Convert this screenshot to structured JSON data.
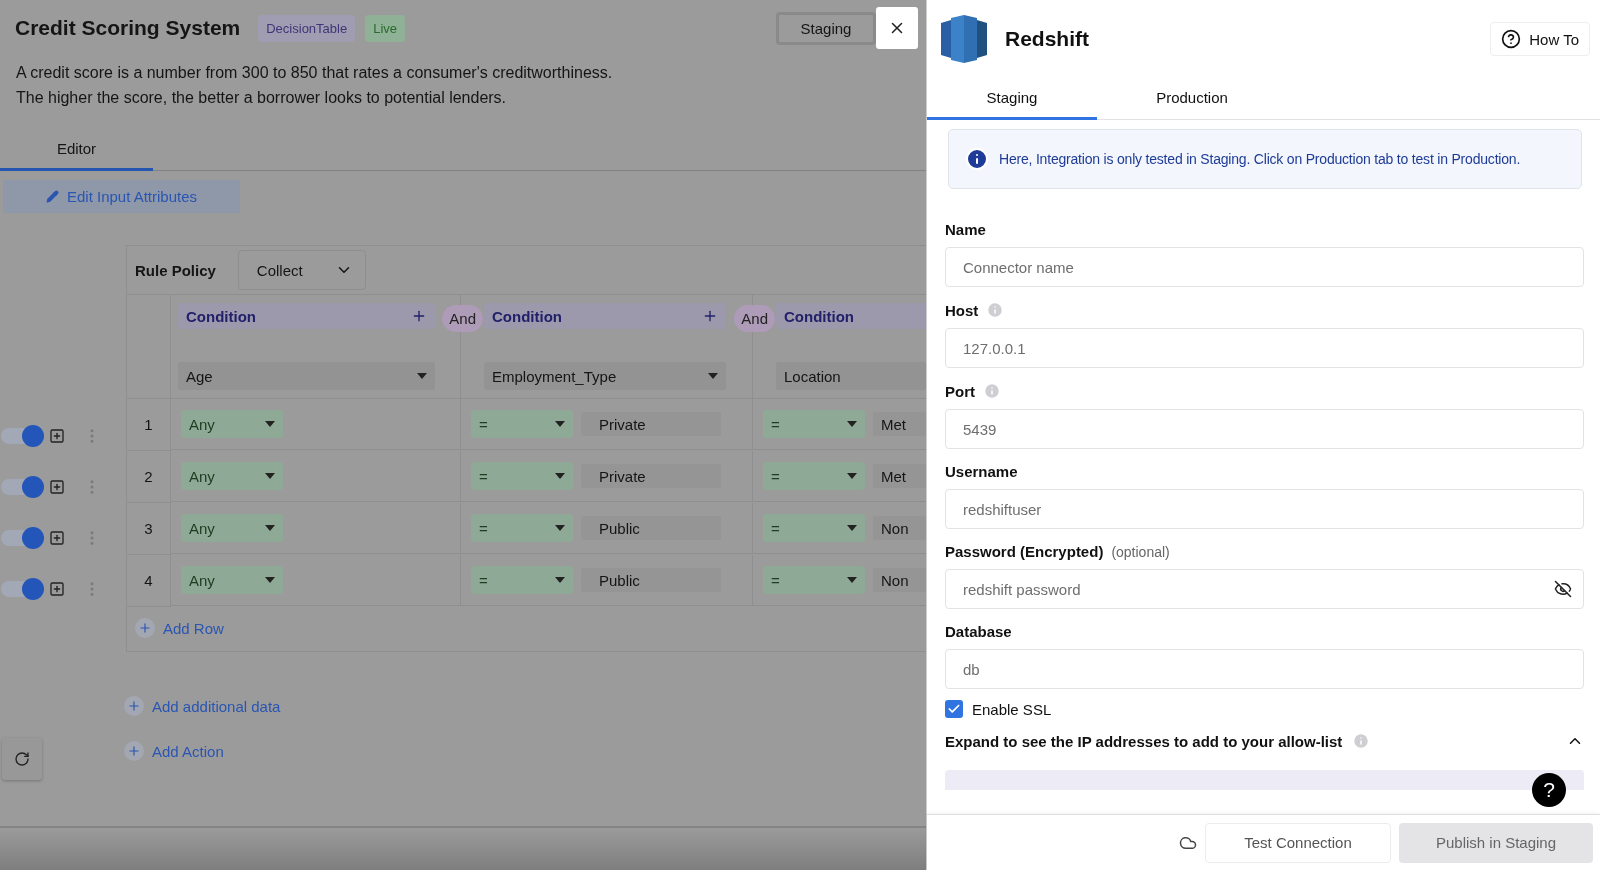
{
  "page": {
    "title": "Credit Scoring System",
    "badges": [
      {
        "label": "DecisionTable",
        "kind": "type"
      },
      {
        "label": "Live",
        "kind": "status"
      }
    ],
    "env_button": "Staging",
    "description": [
      "A credit score is a number from 300 to 850 that rates a consumer's creditworthiness.",
      "The higher the score, the better a borrower looks to potential lenders."
    ],
    "tabs": [
      {
        "label": "Editor",
        "selected": true
      }
    ],
    "edit_button": "Edit Input Attributes"
  },
  "rule_policy": {
    "label": "Rule Policy",
    "value": "Collect"
  },
  "conditions": [
    {
      "label": "Condition",
      "attribute": "Age",
      "connector": "And"
    },
    {
      "label": "Condition",
      "attribute": "Employment_Type",
      "connector": "And"
    },
    {
      "label": "Condition",
      "attribute": "Location"
    }
  ],
  "rows": [
    {
      "number": "1",
      "enabled": true,
      "cells": [
        {
          "operator": "Any"
        },
        {
          "operator": "=",
          "value": "Private"
        },
        {
          "operator": "=",
          "value": "Met"
        }
      ]
    },
    {
      "number": "2",
      "enabled": true,
      "cells": [
        {
          "operator": "Any"
        },
        {
          "operator": "=",
          "value": "Private"
        },
        {
          "operator": "=",
          "value": "Met"
        }
      ]
    },
    {
      "number": "3",
      "enabled": true,
      "cells": [
        {
          "operator": "Any"
        },
        {
          "operator": "=",
          "value": "Public"
        },
        {
          "operator": "=",
          "value": "Non"
        }
      ]
    },
    {
      "number": "4",
      "enabled": true,
      "cells": [
        {
          "operator": "Any"
        },
        {
          "operator": "=",
          "value": "Public"
        },
        {
          "operator": "=",
          "value": "Non"
        }
      ]
    }
  ],
  "add_row": "Add Row",
  "add_links": [
    "Add additional data",
    "Add Action"
  ],
  "panel": {
    "title": "Redshift",
    "how_to": "How To",
    "tabs": [
      {
        "label": "Staging",
        "selected": true
      },
      {
        "label": "Production",
        "selected": false
      }
    ],
    "info": "Here, Integration is only tested in Staging. Click on Production tab to test in Production.",
    "fields": [
      {
        "label": "Name",
        "info": false,
        "placeholder": "Connector name",
        "secret": false
      },
      {
        "label": "Host",
        "info": true,
        "placeholder": "127.0.0.1",
        "secret": false
      },
      {
        "label": "Port",
        "info": true,
        "placeholder": "5439",
        "secret": false
      },
      {
        "label": "Username",
        "info": false,
        "placeholder": "redshiftuser",
        "secret": false
      },
      {
        "label": "Password (Encrypted)",
        "hint": "(optional)",
        "info": false,
        "placeholder": "redshift password",
        "secret": true
      },
      {
        "label": "Database",
        "info": false,
        "placeholder": "db",
        "secret": false
      }
    ],
    "ssl": {
      "label": "Enable SSL",
      "checked": true
    },
    "expand": {
      "label": "Expand to see the IP addresses to add to your allow-list",
      "expanded": true
    },
    "help": "?",
    "test_button": "Test Connection",
    "publish_button": "Publish in Staging"
  }
}
